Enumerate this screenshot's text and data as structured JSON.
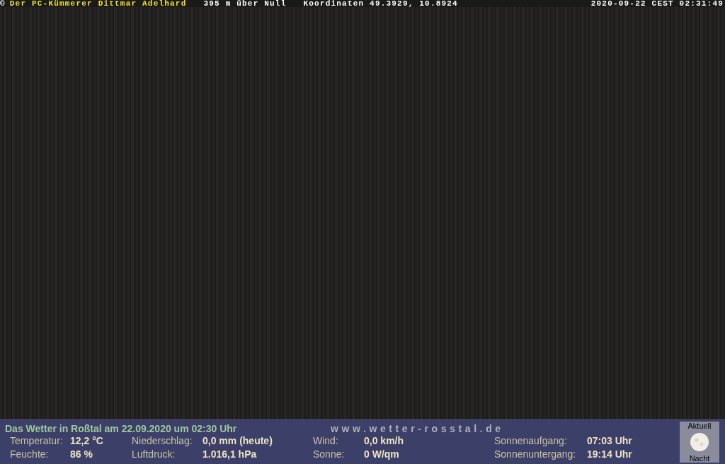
{
  "header": {
    "copyright": "©",
    "items": [
      {
        "text": "Der PC-Kümmerer Dittmar Adelhard",
        "color": "#f0e030"
      },
      {
        "text": "395 m über Null",
        "color": "#ffffff"
      },
      {
        "text": "Koordinaten 49.3929, 10.8924",
        "color": "#ffffff"
      }
    ],
    "timestamp": "2020-09-22 CEST 02:31:49"
  },
  "weather": {
    "title": "Das Wetter in Roßtal am 22.09.2020 um 02:30 Uhr",
    "url": "www.wetter-rosstal.de",
    "readings": [
      {
        "label": "Temperatur:",
        "value": "12,2 °C"
      },
      {
        "label": "Feuchte:",
        "value": "86 %"
      },
      {
        "label": "Niederschlag:",
        "value": "0,0 mm (heute)"
      },
      {
        "label": "Luftdruck:",
        "value": "1.016,1 hPa"
      },
      {
        "label": "Wind:",
        "value": "0,0 km/h"
      },
      {
        "label": "Sonne:",
        "value": "0 W/qm"
      },
      {
        "label": "Sonnenaufgang:",
        "value": "07:03 Uhr"
      },
      {
        "label": "Sonnenuntergang:",
        "value": "19:14 Uhr"
      }
    ],
    "moon": {
      "top": "Aktuell",
      "bottom": "Nacht"
    }
  }
}
